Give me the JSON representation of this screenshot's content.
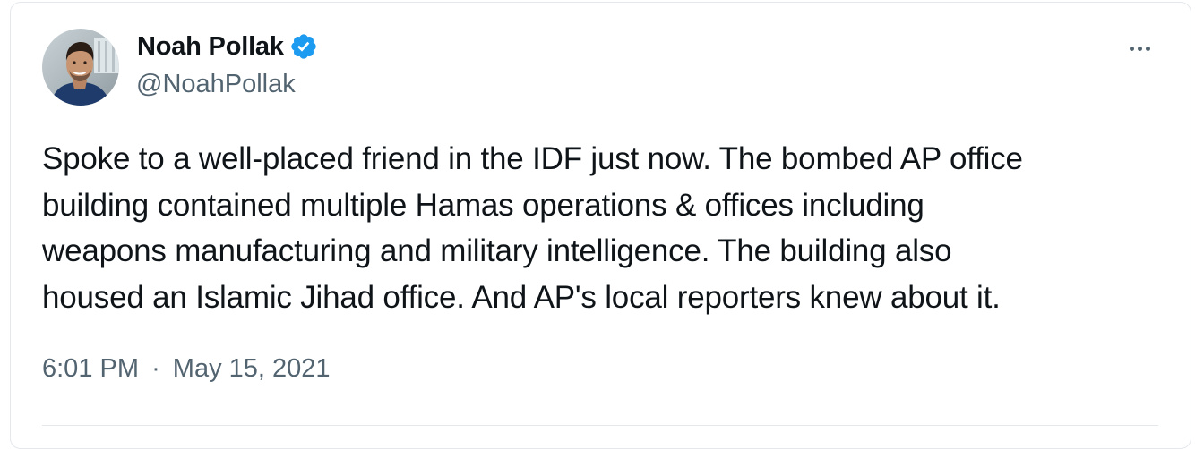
{
  "author": {
    "name": "Noah Pollak",
    "handle": "@NoahPollak",
    "verified_icon": "verified-badge-icon",
    "avatar_icon": "avatar-photo"
  },
  "menu": {
    "icon": "more-options-icon"
  },
  "tweet": {
    "lines": [
      "Spoke to a well-placed friend in the IDF just now. The bombed AP office",
      "building contained multiple Hamas operations & offices including",
      "weapons manufacturing and military intelligence. The building also",
      "housed an Islamic Jihad office. And AP's local reporters knew about it."
    ]
  },
  "meta": {
    "time": "6:01 PM",
    "separator": "·",
    "date": "May 15, 2021"
  },
  "colors": {
    "text": "#0f1419",
    "secondary": "#536471",
    "verified": "#1d9bf0",
    "border": "#e4e8ec"
  }
}
